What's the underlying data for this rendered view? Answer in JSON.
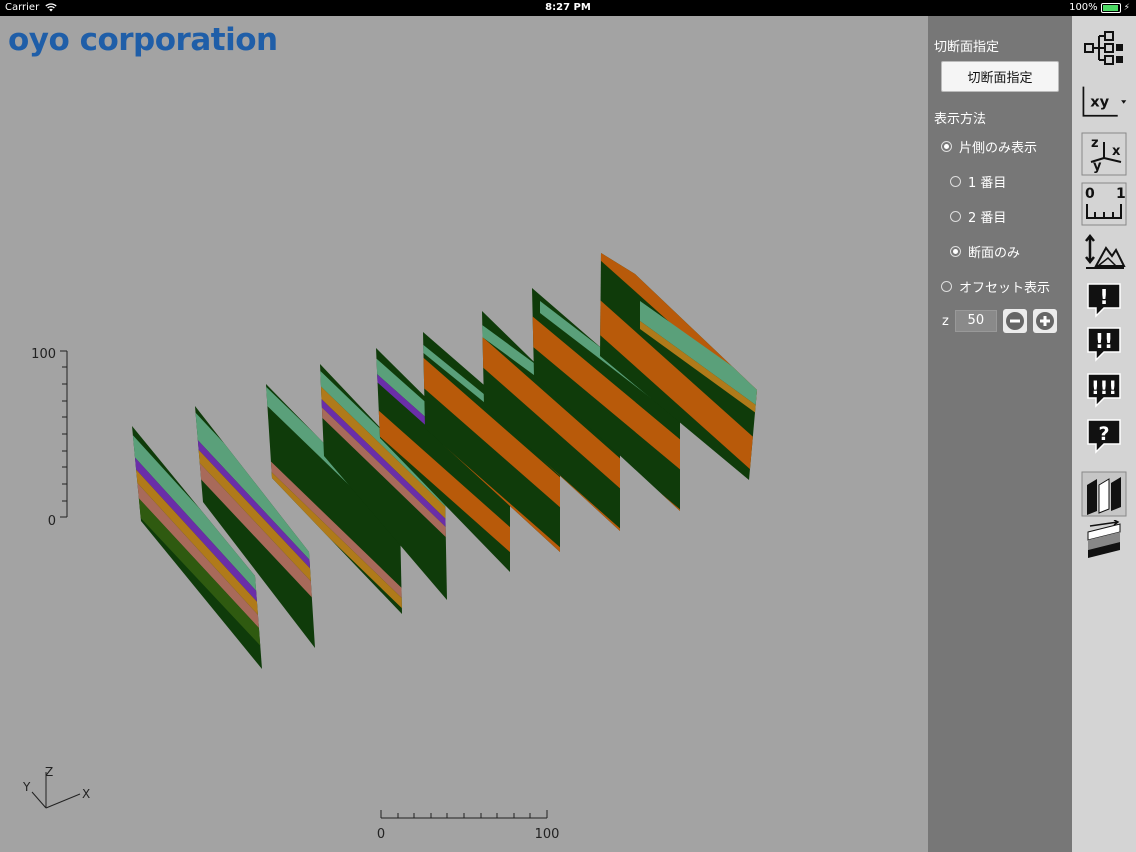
{
  "status": {
    "carrier": "Carrier",
    "time": "8:27 PM",
    "battery": "100%"
  },
  "logo": "oyo corporation",
  "axis": {
    "v_top": "100",
    "v_bottom": "0",
    "h_left": "0",
    "h_right": "100"
  },
  "triad": {
    "x": "X",
    "y": "Y",
    "z": "Z"
  },
  "panel": {
    "section_cut": "切断面指定",
    "cut_button": "切断面指定",
    "section_display": "表示方法",
    "options": [
      {
        "label": "片側のみ表示",
        "selected": true
      },
      {
        "label": "1 番目",
        "selected": false
      },
      {
        "label": "2 番目",
        "selected": false
      },
      {
        "label": "断面のみ",
        "selected": true
      },
      {
        "label": "オフセット表示",
        "selected": false
      }
    ],
    "z_label": "z",
    "z_value": "50"
  },
  "toolbar": {
    "icons": [
      "tree-icon",
      "xy-view-icon",
      "axes-zyx-icon",
      "scale-ruler-icon",
      "terrain-scale-icon",
      "alert-1-icon",
      "alert-2-icon",
      "alert-3-icon",
      "question-icon",
      "cross-section-panels-icon",
      "layer-slice-icon"
    ],
    "xy_label": "xy"
  },
  "colors": {
    "panel_bg": "#777777",
    "viewport_bg": "#a3a3a3",
    "logo": "#1f5ea8",
    "toolbar_bg": "#d4d4d4"
  }
}
